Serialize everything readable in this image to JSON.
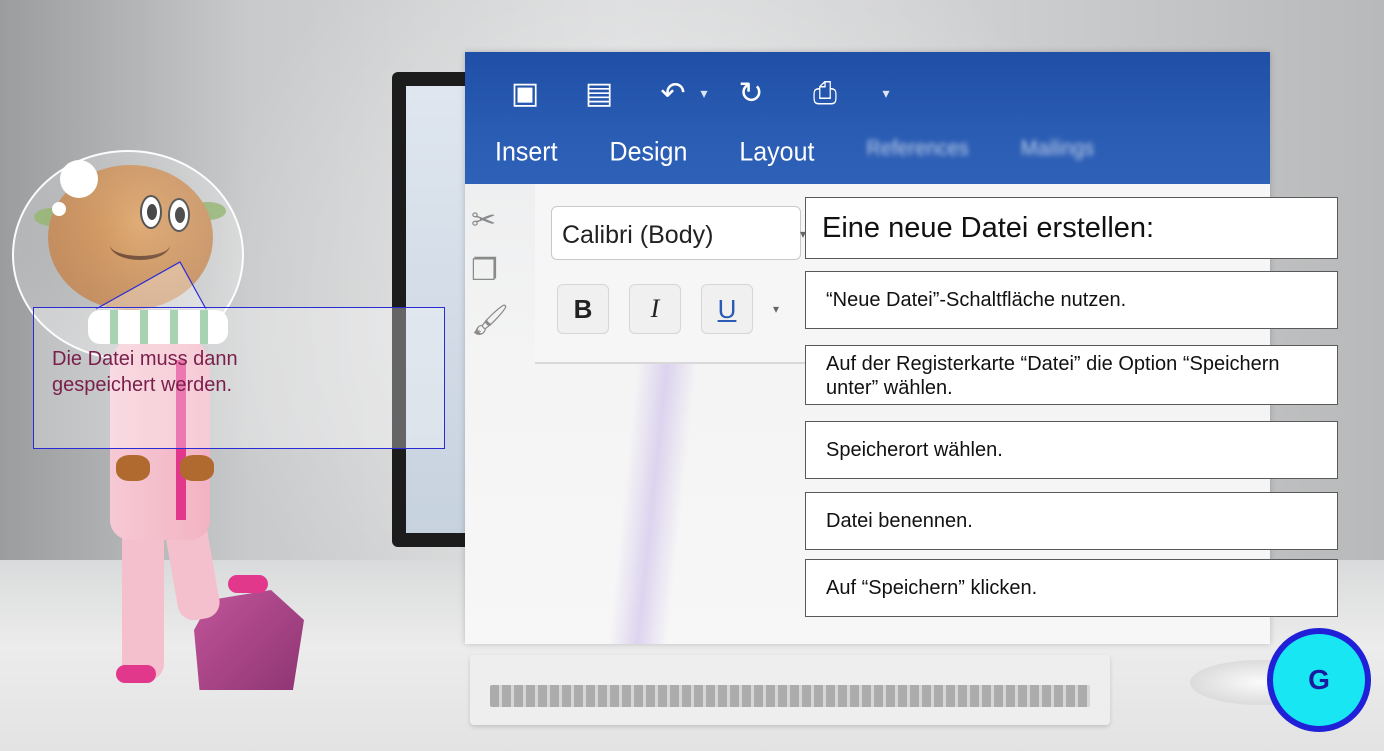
{
  "ribbon": {
    "quick_access_icons": [
      "sidebar-icon",
      "save-icon",
      "undo-icon",
      "redo-icon",
      "print-icon",
      "customize-icon"
    ],
    "tabs": [
      "Insert",
      "Design",
      "Layout",
      "References",
      "Mailings"
    ],
    "font_name": "Calibri (Body)",
    "format_buttons": [
      "B",
      "I",
      "U"
    ]
  },
  "panel": {
    "title": "Eine neue Datei erstellen:",
    "steps": [
      "“Neue Datei”-Schaltfläche nutzen.",
      "Auf der Registerkarte “Datei” die Option “Speichern unter” wählen.",
      "Speicherort wählen.",
      "Datei benennen.",
      "Auf “Speichern” klicken."
    ]
  },
  "speech": {
    "text": "Die Datei muss dann\ngespeichert werden."
  },
  "badge": {
    "label": "G",
    "fill_color": "#18e6f2",
    "border_color": "#2020d8"
  },
  "colors": {
    "ribbon_blue": "#2a5cb3",
    "speech_text": "#7a1f4c"
  }
}
